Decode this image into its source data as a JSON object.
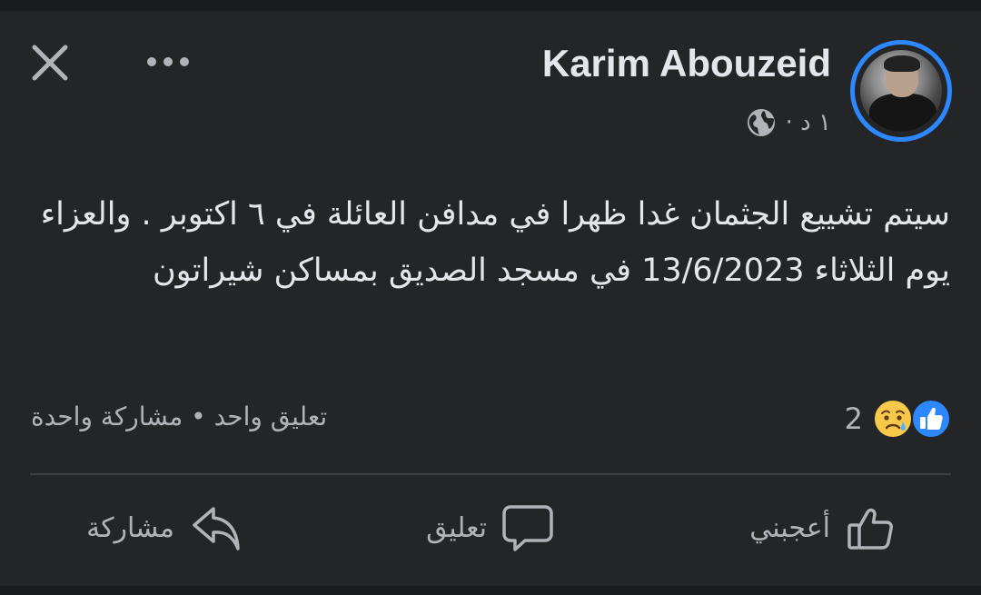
{
  "post": {
    "author": "Karim Abouzeid",
    "time": "١ د ·",
    "privacy_icon": "globe-icon",
    "text": "سيتم تشييع الجثمان غدا ظهرا في مدافن العائلة في ٦ اكتوبر . والعزاء يوم الثلاثاء 13/6/2023 في مسجد الصديق بمساكن شيراتون"
  },
  "reactions": {
    "icons": [
      "like-icon",
      "sad-face-icon"
    ],
    "count": "2",
    "engagement": "تعليق واحد • مشاركة واحدة"
  },
  "actions": {
    "like": "أعجبني",
    "comment": "تعليق",
    "share": "مشاركة"
  },
  "colors": {
    "background": "#242526",
    "accent": "#2d88ff",
    "text": "#e4e6eb",
    "secondary_text": "#b0b3b8"
  }
}
